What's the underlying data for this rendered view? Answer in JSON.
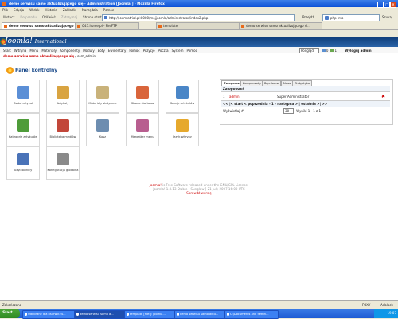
{
  "window": {
    "title": "demo serwisu samo aktualizującego się - Administration [Joomla!] - Mozilla Firefox",
    "buttons": [
      "_",
      "□",
      "×"
    ]
  },
  "menubar": [
    "Plik",
    "Edycja",
    "Widok",
    "Historia",
    "Zakładki",
    "Narzędzia",
    "Pomoc"
  ],
  "navbar": {
    "back": "Wstecz",
    "forward": "Do przodu",
    "reload": "Odśwież",
    "stop": "Zatrzymaj",
    "home": "Strona startowa",
    "url": "http://joomlatrial.pl:8080/mojjoomla/administrator/index2.php",
    "go": "Przejdź",
    "search_value": "php info",
    "search_btn": "Szukaj"
  },
  "bookmarks": [
    {
      "label": "demo serwisu samo aktualizującego się"
    },
    {
      "label": "Q47.home.pl - FireFTP"
    },
    {
      "label": "template"
    },
    {
      "label": "demo serwisu samo aktualizującego si..."
    }
  ],
  "joomla": {
    "logo": "Joomla!",
    "logo_sub": "International",
    "menu": [
      "Start",
      "Witryna",
      "Menu",
      "Materiały",
      "Komponenty",
      "Moduły",
      "Boty",
      "Ewidentary",
      "Pomoc",
      "Pozycje",
      "Poczta",
      "System",
      "Pomoc"
    ],
    "preview_select": "Podgląd",
    "counts": [
      "0",
      "1"
    ],
    "logout": "Wyloguj admin",
    "breadcrumb_site": "demo serwisu samo aktualizującego się",
    "breadcrumb_user": "/ com_admin",
    "panel_title": "Panel kontrolny",
    "icons": [
      {
        "label": "Dodaj artykuł",
        "color": "#5b8fd6"
      },
      {
        "label": "Artykuły",
        "color": "#d9a441"
      },
      {
        "label": "Materiały statyczne",
        "color": "#c9b27a"
      },
      {
        "label": "Strona startowa",
        "color": "#d9653b"
      },
      {
        "label": "Sekcje artykułów",
        "color": "#4a86c7"
      },
      {
        "label": "Kategorie artykułów",
        "color": "#4f9c3a"
      },
      {
        "label": "Biblioteka mediów",
        "color": "#c2473a"
      },
      {
        "label": "Kosz",
        "color": "#6d8db0"
      },
      {
        "label": "Menedżer menu",
        "color": "#b85e8f"
      },
      {
        "label": "Język witryny",
        "color": "#e6a92d"
      },
      {
        "label": "Użytkownicy",
        "color": "#4a73b8"
      },
      {
        "label": "Konfiguracja globalna",
        "color": "#8a8a8a"
      }
    ],
    "tabs": [
      "Zalogowani",
      "Komponenty",
      "Popularne",
      "Nowe",
      "Statystyka"
    ],
    "logged": {
      "header": "Zalogowani",
      "rows": [
        {
          "num": "1",
          "user": "admin",
          "role": "Super Administrator"
        }
      ],
      "pagination": "<< |< start < poprzednia - 1 - następna > | ostatnia >| >>",
      "per_page_label": "Wyświetlaj #",
      "per_page_value": "30",
      "results": "Wyniki 1 - 1 z 1"
    },
    "footer_line1_link": "Joomla!",
    "footer_line1_rest": " is Free Software released under the GNU/GPL License.",
    "footer_line2": "Joomla! 1.0.13 Stable [ Sunglow ] 21 July 2007 16:00 UTC",
    "footer_line3": "Sprawdź wersję"
  },
  "status": {
    "left": "Zakończono",
    "right1": "FOXY",
    "right2": "Adblock"
  },
  "taskbar": {
    "start": "Start",
    "tasks": [
      "Odebrane dla bsurwik24...",
      "demo serwisu samo a...",
      "template [file:]: Joomla...",
      "demo serwisu samo aktu...",
      "C:\\Documents and Settin..."
    ],
    "clock": "19:07"
  }
}
